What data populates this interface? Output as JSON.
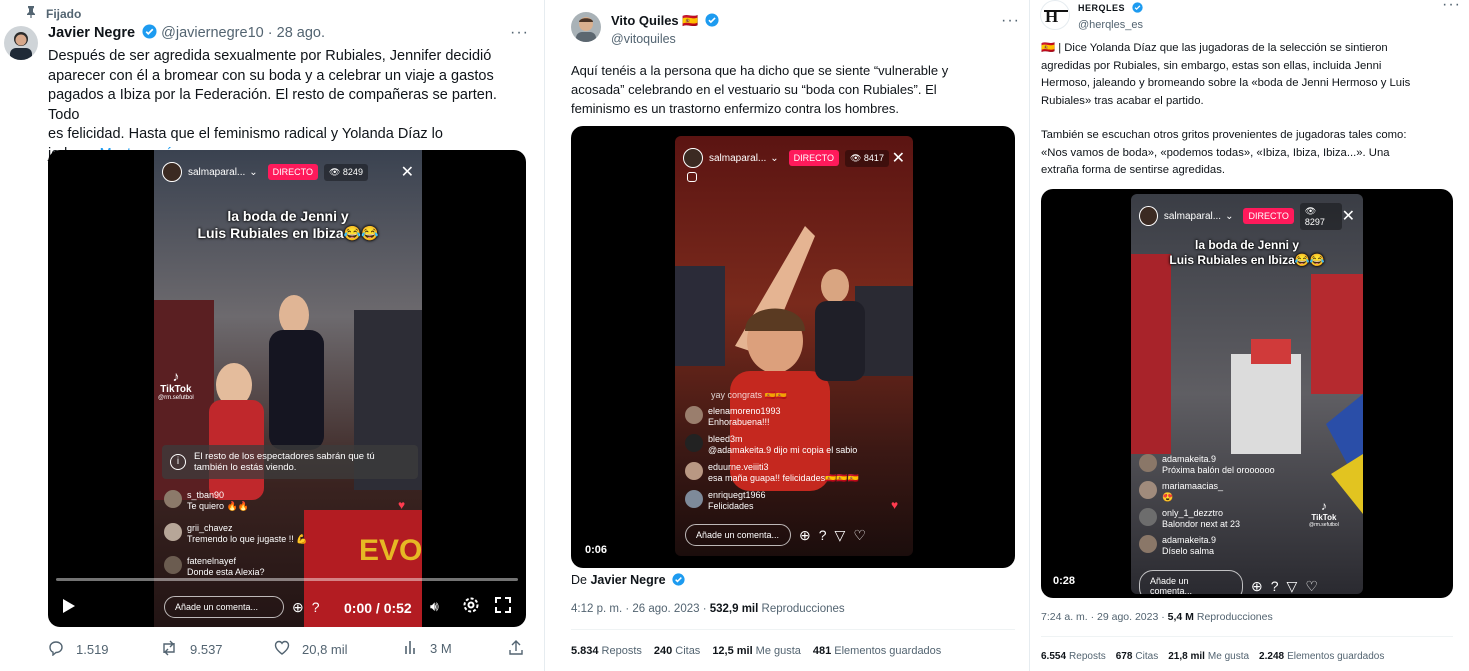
{
  "tweet1": {
    "pinned_label": "Fijado",
    "name": "Javier Negre",
    "handle": "@javiernegre10",
    "dot": "·",
    "date": "28 ago.",
    "text_lines": [
      "Después de ser agredida sexualmente por Rubiales, Jennifer decidió",
      "aparecer con él a bromear con su boda y a celebrar un viaje a gastos",
      "pagados a Ibiza por la Federación. El resto de compañeras se parten. Todo",
      "es felicidad. Hasta que el feminismo radical y Yolanda Díaz lo"
    ],
    "last_line": "joden...",
    "show_more": "Mostrar más",
    "video": {
      "username": "salmaparal...",
      "live_label": "DIRECTO",
      "viewers": "8249",
      "caption_line1": "la boda de Jenni y",
      "caption_line2": "Luis Rubiales en Ibiza😂😂",
      "tiktok": "TikTok",
      "tiktok_user": "@rm.sefutbol",
      "notice": "El resto de los espectadores sabrán que tú también lo estás viendo.",
      "comments": [
        {
          "user": "s_tban90",
          "text": "Te quiero 🔥🔥"
        },
        {
          "user": "grii_chavez",
          "text": "Tremendo lo que jugaste !! 💪"
        },
        {
          "user": "fatenelnayef",
          "text": "Donde esta Alexia?"
        }
      ],
      "input_placeholder": "Añade un comenta...",
      "time": "0:00 / 0:52",
      "progress": 0.0
    },
    "actions": {
      "replies": "1.519",
      "retweets": "9.537",
      "likes": "20,8 mil",
      "views": "3 M"
    }
  },
  "tweet2": {
    "name": "Vito Quiles",
    "flag": "🇪🇸",
    "handle": "@vitoquiles",
    "text_lines": [
      "Aquí tenéis a la persona que ha dicho que se siente “vulnerable y",
      "acosada” celebrando en el vestuario su “boda con Rubiales”. El",
      "feminismo es un trastorno enfermizo contra los hombres."
    ],
    "video": {
      "username": "salmaparal...",
      "live_label": "DIRECTO",
      "viewers": "8417",
      "comments": [
        {
          "user": "",
          "text": "yay congrats 🇪🇸🇪🇸"
        },
        {
          "user": "elenamoreno1993",
          "text": "Enhorabuena!!!"
        },
        {
          "user": "bleed3m",
          "text": "@adamakeita.9 dijo mi copia el sabio"
        },
        {
          "user": "eduurne.veiiiti3",
          "text": "esa maña guapa!! felicidades🇪🇸🇪🇸🇪🇸"
        },
        {
          "user": "enriquegt1966",
          "text": "Felicidades"
        }
      ],
      "input_placeholder": "Añade un comenta...",
      "duration": "0:06"
    },
    "from_label": "De",
    "from_name": "Javier Negre",
    "meta_time": "4:12 p. m. · 26 ago. 2023 ·",
    "views_count": "532,9 mil",
    "views_label": "Reproducciones",
    "stats": [
      {
        "value": "5.834",
        "label": "Reposts"
      },
      {
        "value": "240",
        "label": "Citas"
      },
      {
        "value": "12,5 mil",
        "label": "Me gusta"
      },
      {
        "value": "481",
        "label": "Elementos guardados"
      }
    ]
  },
  "tweet3": {
    "name": "HERQLES",
    "handle": "@herqles_es",
    "text_p1": [
      "🇪🇸 | Dice Yolanda Díaz que las jugadoras de la selección se sintieron",
      "agredidas por Rubiales, sin embargo, estas son ellas, incluida Jenni",
      "Hermoso, jaleando y bromeando sobre la «boda de Jenni Hermoso y Luis",
      "Rubiales» tras acabar el partido."
    ],
    "text_p2": [
      "También se escuchan otros gritos provenientes de jugadoras tales como:",
      "«Nos vamos de boda», «podemos todas», «Ibiza, Ibiza, Ibiza...». Una",
      "extraña forma de sentirse agredidas."
    ],
    "video": {
      "username": "salmaparal...",
      "live_label": "DIRECTO",
      "viewers": "8297",
      "caption_line1": "la boda de Jenni y",
      "caption_line2": "Luis Rubiales en Ibiza😂😂",
      "tiktok": "TikTok",
      "tiktok_user": "@rm.sefutbol",
      "comments": [
        {
          "user": "adamakeita.9",
          "text": "Próxima balón del oroooooo"
        },
        {
          "user": "mariamaacias_",
          "text": "😍"
        },
        {
          "user": "only_1_dezztro",
          "text": "Balondor next at 23"
        },
        {
          "user": "adamakeita.9",
          "text": "Díselo salma"
        }
      ],
      "input_placeholder": "Añade un comenta...",
      "duration": "0:28"
    },
    "meta_time": "7:24 a. m. · 29 ago. 2023 ·",
    "views_count": "5,4 M",
    "views_label": "Reproducciones",
    "stats": [
      {
        "value": "6.554",
        "label": "Reposts"
      },
      {
        "value": "678",
        "label": "Citas"
      },
      {
        "value": "21,8 mil",
        "label": "Me gusta"
      },
      {
        "value": "2.248",
        "label": "Elementos guardados"
      }
    ]
  },
  "more_glyph": "···",
  "colors": {
    "accent": "#1d9bf0",
    "live": "#ff1a5b",
    "muted": "#536471"
  }
}
